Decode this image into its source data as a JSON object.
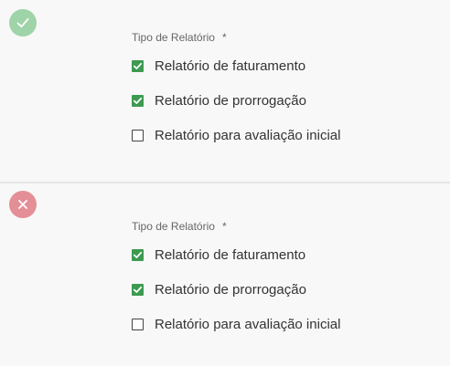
{
  "colors": {
    "background": "#f8f8f8",
    "success_icon_bg": "#9fd3a8",
    "error_icon_bg": "#e38f95",
    "checkbox_checked": "#3d9a50"
  },
  "panels": [
    {
      "status_icon": "check-icon",
      "field_label": "Tipo de Relatório",
      "required_mark": "*",
      "options": [
        {
          "label": "Relatório de faturamento",
          "checked": true
        },
        {
          "label": "Relatório de prorrogação",
          "checked": true
        },
        {
          "label": "Relatório para avaliação inicial",
          "checked": false
        }
      ]
    },
    {
      "status_icon": "close-icon",
      "field_label": "Tipo de Relatório",
      "required_mark": "*",
      "options": [
        {
          "label": "Relatório de faturamento",
          "checked": true
        },
        {
          "label": "Relatório de prorrogação",
          "checked": true
        },
        {
          "label": "Relatório para avaliação inicial",
          "checked": false
        }
      ]
    }
  ]
}
